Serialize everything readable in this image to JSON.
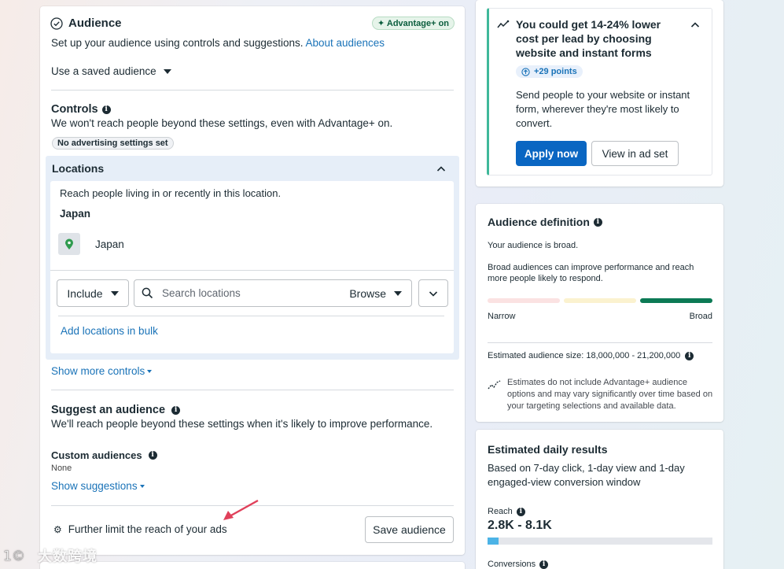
{
  "audience": {
    "title": "Audience",
    "advantage_badge": "Advantage+ on",
    "subtitle": "Set up your audience using controls and suggestions.",
    "about_link": "About audiences",
    "saved_audience": "Use a saved audience"
  },
  "controls": {
    "title": "Controls",
    "description": "We won't reach people beyond these settings, even with Advantage+ on.",
    "badge": "No advertising settings set"
  },
  "locations": {
    "title": "Locations",
    "description": "Reach people living in or recently in this location.",
    "country_header": "Japan",
    "item": "Japan",
    "include_label": "Include",
    "search_placeholder": "Search locations",
    "browse_label": "Browse",
    "bulk_link": "Add locations in bulk"
  },
  "show_more_controls": "Show more controls",
  "suggest": {
    "title": "Suggest an audience",
    "description": "We'll reach people beyond these settings when it's likely to improve performance.",
    "custom_title": "Custom audiences",
    "custom_value": "None",
    "show_suggestions": "Show suggestions"
  },
  "further_limit": "Further limit the reach of your ads",
  "save_audience": "Save audience",
  "promo": {
    "title": "You could get 14-24% lower cost per lead by choosing website and instant forms",
    "points": "+29 points",
    "body": "Send people to your website or instant form, wherever they're most likely to convert.",
    "apply_label": "Apply now",
    "view_label": "View in ad set"
  },
  "definition": {
    "title": "Audience definition",
    "broad_line": "Your audience is broad.",
    "broad_desc": "Broad audiences can improve performance and reach more people likely to respond.",
    "narrow_label": "Narrow",
    "broad_label": "Broad",
    "size_label": "Estimated audience size: 18,000,000 - 21,200,000",
    "estimates_note": "Estimates do not include Advantage+ audience options and may vary significantly over time based on your targeting selections and available data."
  },
  "daily": {
    "title": "Estimated daily results",
    "window": "Based on 7-day click, 1-day view and 1-day engaged-view conversion window",
    "reach_label": "Reach",
    "reach_value": "2.8K - 8.1K",
    "conversions_label": "Conversions"
  },
  "watermark": "大数跨境",
  "colors": {
    "accent": "#1a73b8",
    "primary_button": "#0a66c2",
    "promo_border": "#3fb89a",
    "meter_green": "#0c7a55",
    "reach_bar": "#4cb3e6"
  }
}
